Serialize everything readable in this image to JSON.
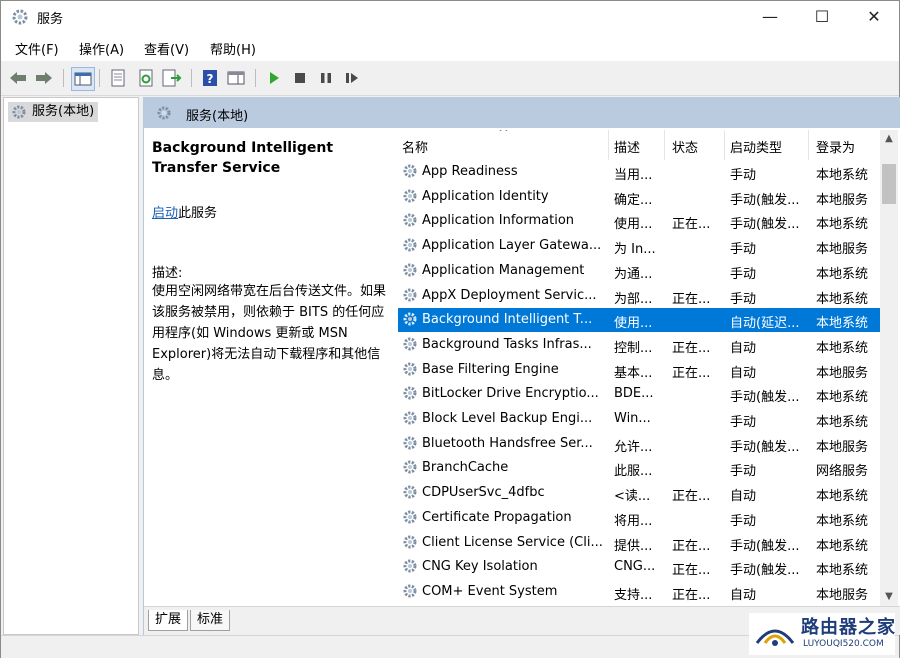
{
  "window": {
    "title": "服务",
    "minimize": "—",
    "maximize": "☐",
    "close": "✕"
  },
  "menu": [
    "文件(F)",
    "操作(A)",
    "查看(V)",
    "帮助(H)"
  ],
  "tree": {
    "item": "服务(本地)"
  },
  "panel": {
    "header": "服务(本地)",
    "service_name": "Background Intelligent Transfer Service",
    "start_link": "启动",
    "start_suffix": "此服务",
    "desc_label": "描述:",
    "desc_text": "使用空闲网络带宽在后台传送文件。如果该服务被禁用，则依赖于 BITS 的任何应用程序(如 Windows 更新或 MSN Explorer)将无法自动下载程序和其他信息。"
  },
  "columns": {
    "name": "名称",
    "desc": "描述",
    "status": "状态",
    "startup": "启动类型",
    "logon": "登录为"
  },
  "services": [
    {
      "name": "App Readiness",
      "desc": "当用...",
      "status": "",
      "startup": "手动",
      "logon": "本地系统",
      "selected": false
    },
    {
      "name": "Application Identity",
      "desc": "确定...",
      "status": "",
      "startup": "手动(触发...",
      "logon": "本地服务",
      "selected": false
    },
    {
      "name": "Application Information",
      "desc": "使用...",
      "status": "正在...",
      "startup": "手动(触发...",
      "logon": "本地系统",
      "selected": false
    },
    {
      "name": "Application Layer Gatewa...",
      "desc": "为 In...",
      "status": "",
      "startup": "手动",
      "logon": "本地服务",
      "selected": false
    },
    {
      "name": "Application Management",
      "desc": "为通...",
      "status": "",
      "startup": "手动",
      "logon": "本地系统",
      "selected": false
    },
    {
      "name": "AppX Deployment Servic...",
      "desc": "为部...",
      "status": "正在...",
      "startup": "手动",
      "logon": "本地系统",
      "selected": false
    },
    {
      "name": "Background Intelligent T...",
      "desc": "使用...",
      "status": "",
      "startup": "自动(延迟...",
      "logon": "本地系统",
      "selected": true
    },
    {
      "name": "Background Tasks Infras...",
      "desc": "控制...",
      "status": "正在...",
      "startup": "自动",
      "logon": "本地系统",
      "selected": false
    },
    {
      "name": "Base Filtering Engine",
      "desc": "基本...",
      "status": "正在...",
      "startup": "自动",
      "logon": "本地服务",
      "selected": false
    },
    {
      "name": "BitLocker Drive Encryptio...",
      "desc": "BDE...",
      "status": "",
      "startup": "手动(触发...",
      "logon": "本地系统",
      "selected": false
    },
    {
      "name": "Block Level Backup Engi...",
      "desc": "Win...",
      "status": "",
      "startup": "手动",
      "logon": "本地系统",
      "selected": false
    },
    {
      "name": "Bluetooth Handsfree Ser...",
      "desc": "允许...",
      "status": "",
      "startup": "手动(触发...",
      "logon": "本地服务",
      "selected": false
    },
    {
      "name": "BranchCache",
      "desc": "此服...",
      "status": "",
      "startup": "手动",
      "logon": "网络服务",
      "selected": false
    },
    {
      "name": "CDPUserSvc_4dfbc",
      "desc": "<读...",
      "status": "正在...",
      "startup": "自动",
      "logon": "本地系统",
      "selected": false
    },
    {
      "name": "Certificate Propagation",
      "desc": "将用...",
      "status": "",
      "startup": "手动",
      "logon": "本地系统",
      "selected": false
    },
    {
      "name": "Client License Service (Cli...",
      "desc": "提供...",
      "status": "正在...",
      "startup": "手动(触发...",
      "logon": "本地系统",
      "selected": false
    },
    {
      "name": "CNG Key Isolation",
      "desc": "CNG...",
      "status": "正在...",
      "startup": "手动(触发...",
      "logon": "本地系统",
      "selected": false
    },
    {
      "name": "COM+ Event System",
      "desc": "支持...",
      "status": "正在...",
      "startup": "自动",
      "logon": "本地服务",
      "selected": false
    }
  ],
  "tabs": [
    "扩展",
    "标准"
  ],
  "watermark": {
    "big": "路由器之家",
    "small": "LUYOUQI520.COM"
  }
}
